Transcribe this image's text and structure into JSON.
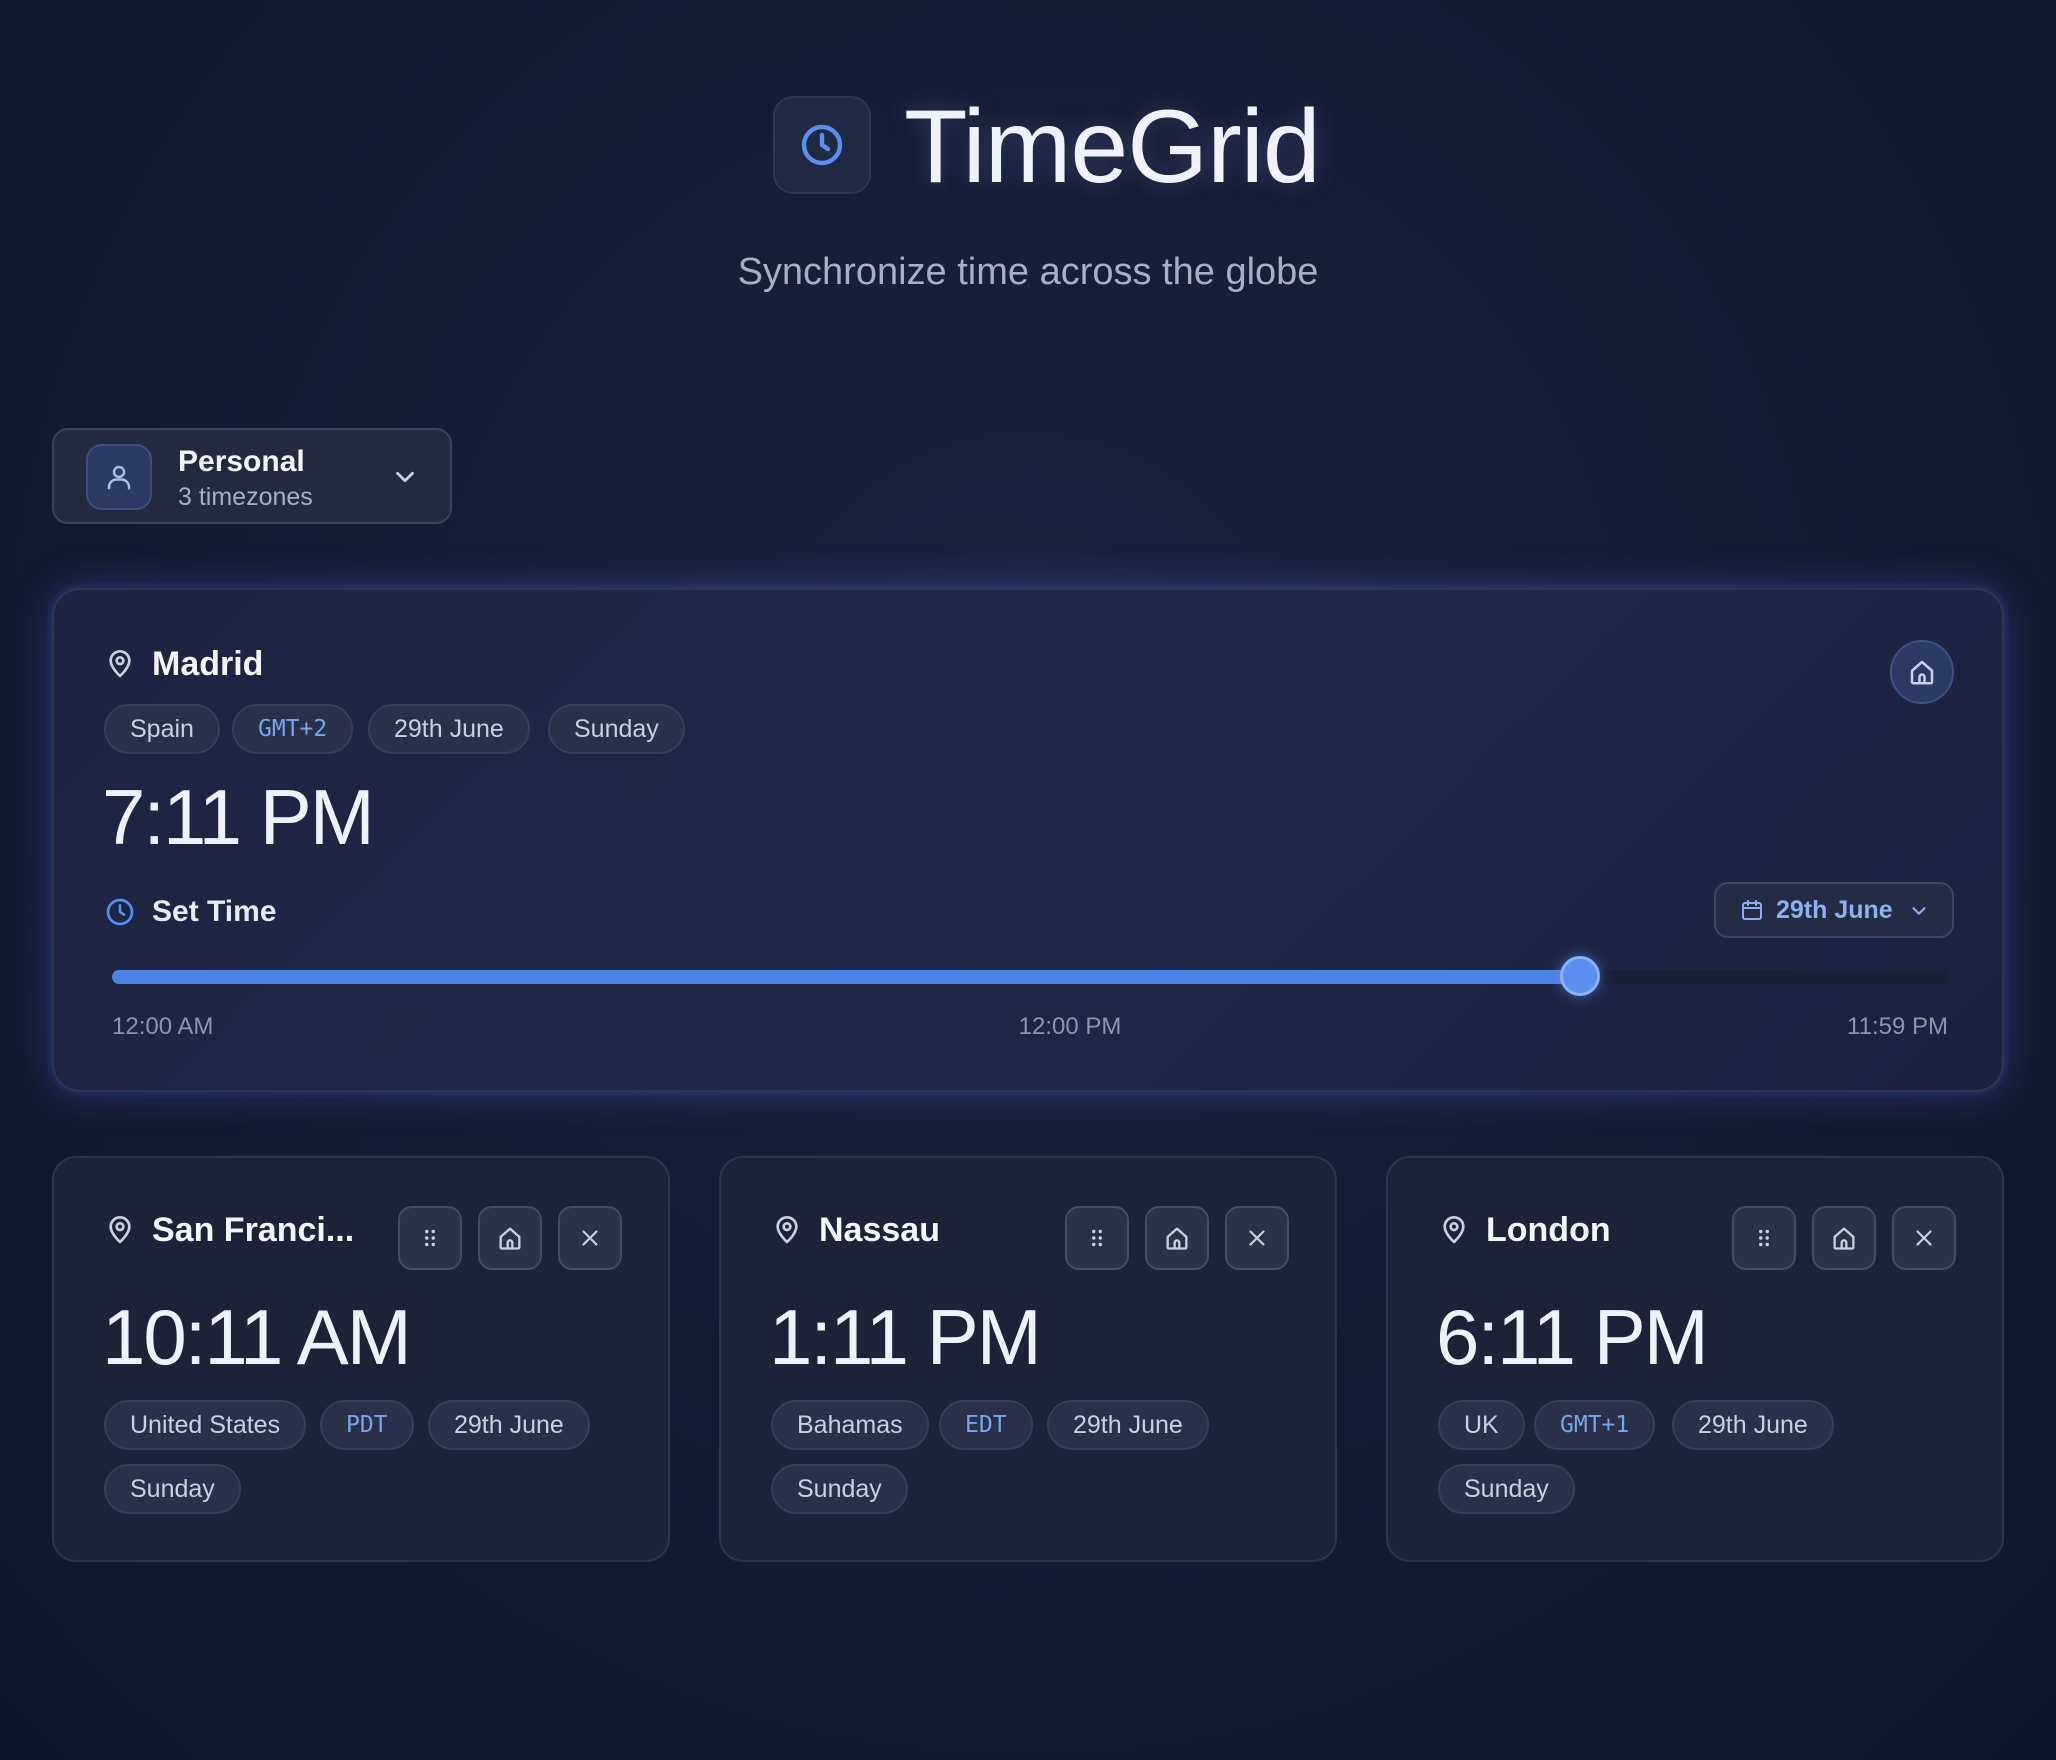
{
  "header": {
    "title": "TimeGrid",
    "subtitle": "Synchronize time across the globe"
  },
  "group_selector": {
    "name": "Personal",
    "count": "3 timezones"
  },
  "home_zone": {
    "city": "Madrid",
    "country": "Spain",
    "tz": "GMT+2",
    "date": "29th June",
    "weekday": "Sunday",
    "time": "7:11 PM",
    "set_time_label": "Set Time",
    "date_picker_label": "29th June",
    "slider": {
      "value_fraction": 0.7993,
      "start_label": "12:00 AM",
      "mid_label": "12:00 PM",
      "end_label": "11:59 PM"
    }
  },
  "zones": [
    {
      "city": "San Franci...",
      "time": "10:11 AM",
      "country": "United States",
      "tz": "PDT",
      "date": "29th June",
      "weekday": "Sunday"
    },
    {
      "city": "Nassau",
      "time": "1:11 PM",
      "country": "Bahamas",
      "tz": "EDT",
      "date": "29th June",
      "weekday": "Sunday"
    },
    {
      "city": "London",
      "time": "6:11 PM",
      "country": "UK",
      "tz": "GMT+1",
      "date": "29th June",
      "weekday": "Sunday"
    }
  ],
  "colors": {
    "accent": "#4d82e6",
    "tz_text": "#7ea2ea",
    "background": "#131a2f"
  },
  "icons": {
    "logo": "clock-icon",
    "group": "user-icon",
    "location": "map-pin-icon",
    "home": "home-icon",
    "drag": "grip-vertical-icon",
    "remove": "close-icon",
    "calendar": "calendar-icon",
    "chevron": "chevron-down-icon"
  }
}
